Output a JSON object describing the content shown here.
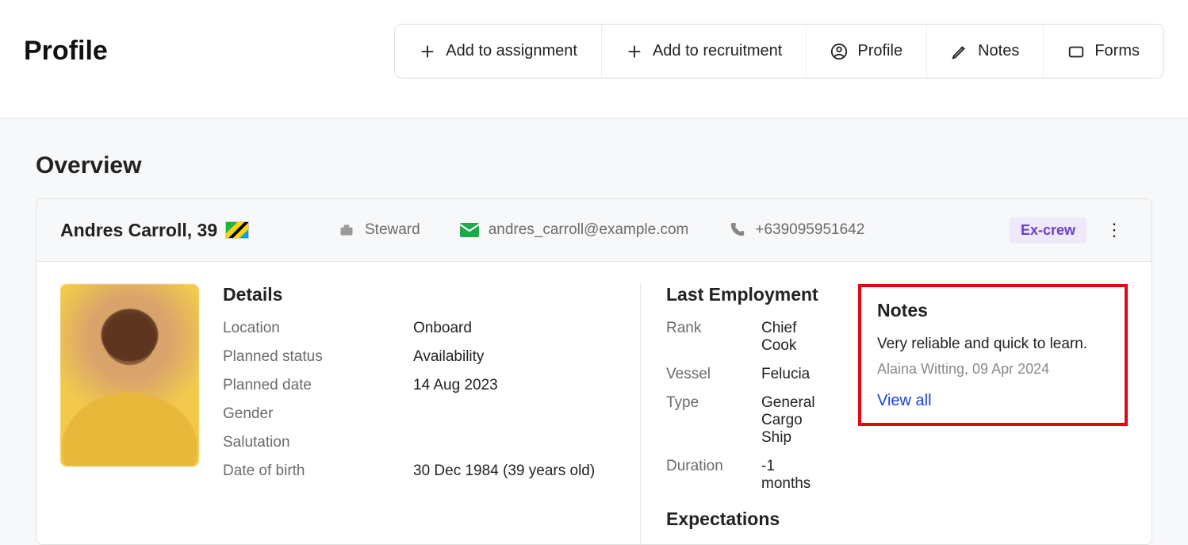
{
  "header": {
    "title": "Profile",
    "actions": {
      "add_assignment": "Add to assignment",
      "add_recruitment": "Add to recruitment",
      "profile": "Profile",
      "notes": "Notes",
      "forms": "Forms"
    }
  },
  "section": {
    "title": "Overview"
  },
  "person": {
    "name": "Andres Carroll",
    "age": "39",
    "name_line": "Andres Carroll, 39",
    "role": "Steward",
    "email": "andres_carroll@example.com",
    "phone": "+639095951642",
    "status_badge": "Ex-crew"
  },
  "details": {
    "heading": "Details",
    "rows": {
      "location_label": "Location",
      "location_value": "Onboard",
      "planned_status_label": "Planned status",
      "planned_status_value": "Availability",
      "planned_date_label": "Planned date",
      "planned_date_value": "14 Aug 2023",
      "gender_label": "Gender",
      "gender_value": "",
      "salutation_label": "Salutation",
      "salutation_value": "",
      "dob_label": "Date of birth",
      "dob_value": "30 Dec 1984 (39 years old)"
    }
  },
  "last_employment": {
    "heading": "Last Employment",
    "rank_label": "Rank",
    "rank_value": "Chief Cook",
    "vessel_label": "Vessel",
    "vessel_value": "Felucia",
    "type_label": "Type",
    "type_value": "General Cargo Ship",
    "duration_label": "Duration",
    "duration_value": "-1 months"
  },
  "expectations": {
    "heading": "Expectations"
  },
  "notes": {
    "heading": "Notes",
    "text": "Very reliable and quick to learn.",
    "author_line": "Alaina Witting, 09 Apr 2024",
    "view_all": "View all"
  }
}
